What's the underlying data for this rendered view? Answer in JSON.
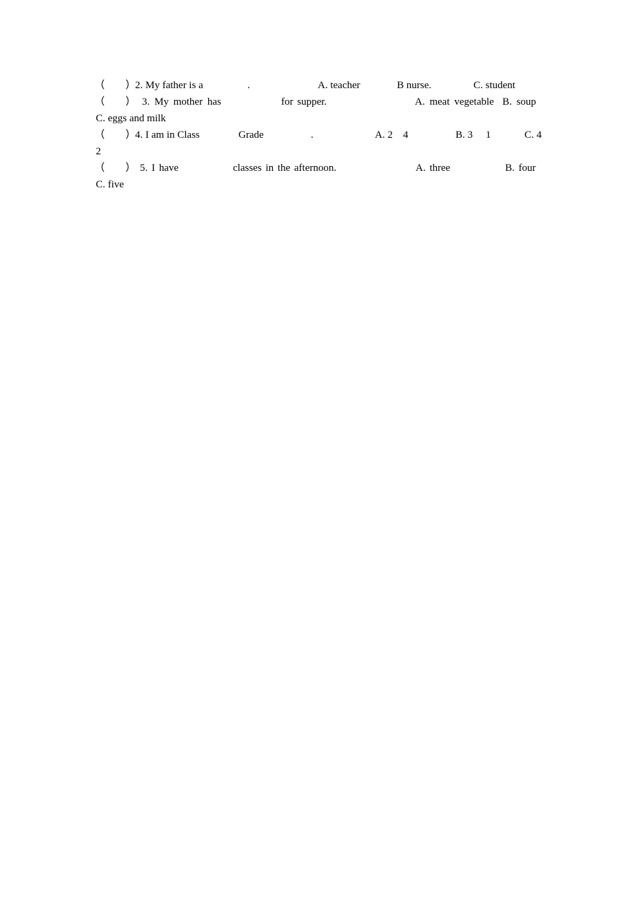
{
  "questions": [
    {
      "number": "2",
      "paren": "（　　）",
      "stem_part1": "2. My father is a",
      "stem_part2": ".",
      "options": [
        "A. teacher",
        "B nurse.",
        "C. student"
      ]
    },
    {
      "number": "3",
      "paren": "（　　）",
      "stem_part1": "3. My mother has",
      "stem_part2": "for supper.",
      "options": [
        "A. meat vegetable",
        "B. soup",
        "C. eggs and milk"
      ]
    },
    {
      "number": "4",
      "paren": "（　　）",
      "stem_part1": "4. I am in Class",
      "stem_part2": "Grade",
      "stem_part3": ".",
      "options": [
        "A. 2    4",
        "B. 3     1",
        "C. 4",
        "2"
      ]
    },
    {
      "number": "5",
      "paren": "（　　）",
      "stem_part1": "5. I have",
      "stem_part2": "classes in the afternoon.",
      "options": [
        "A. three",
        "B. four",
        "C. five"
      ]
    }
  ]
}
